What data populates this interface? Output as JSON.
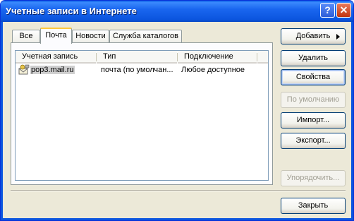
{
  "window": {
    "title": "Учетные записи в Интернете",
    "help_glyph": "?",
    "close_glyph": "✕"
  },
  "tabs": [
    {
      "label": "Все"
    },
    {
      "label": "Почта"
    },
    {
      "label": "Новости"
    },
    {
      "label": "Служба каталогов"
    }
  ],
  "active_tab": "Почта",
  "list": {
    "columns": [
      "Учетная запись",
      "Тип",
      "Подключение"
    ],
    "rows": [
      {
        "account": "pop3.mail.ru",
        "type": "почта (по умолчан...",
        "connection": "Любое доступное",
        "icon": "mail-account-icon"
      }
    ]
  },
  "buttons": {
    "add": "Добавить",
    "remove": "Удалить",
    "properties": "Свойства",
    "set_default": "По умолчанию",
    "import": "Импорт...",
    "export": "Экспорт...",
    "order": "Упорядочить...",
    "close": "Закрыть"
  },
  "colors": {
    "titlebar": "#0b55df",
    "tab_highlight": "#ffc83c",
    "face": "#ece9d8"
  }
}
